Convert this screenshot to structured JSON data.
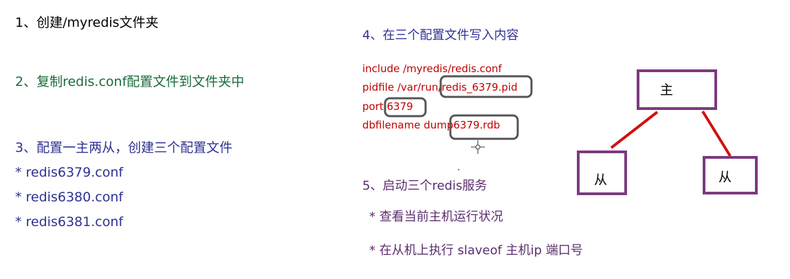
{
  "steps": {
    "step1": "1、创建/myredis文件夹",
    "step2": "2、复制redis.conf配置文件到文件夹中",
    "step3": "3、配置一主两从，创建三个配置文件",
    "config_files": [
      "* redis6379.conf",
      "* redis6380.conf",
      "* redis6381.conf"
    ],
    "step4": "4、在三个配置文件写入内容",
    "config_lines": [
      "include /myredis/redis.conf",
      "pidfile /var/run/redis_6379.pid",
      "port 6379",
      "dbfilename dump6379.rdb"
    ],
    "step5": "5、启动三个redis服务",
    "bullets": [
      "* 查看当前主机运行状况",
      "* 在从机上执行 slaveof  主机ip 端口号"
    ]
  },
  "diagram": {
    "master_label": "主",
    "slave_left_label": "从",
    "slave_right_label": "从"
  },
  "colors": {
    "box_border": "#7b3a80",
    "line": "#d01010",
    "highlight": "#555555",
    "config_text": "#c00000"
  }
}
